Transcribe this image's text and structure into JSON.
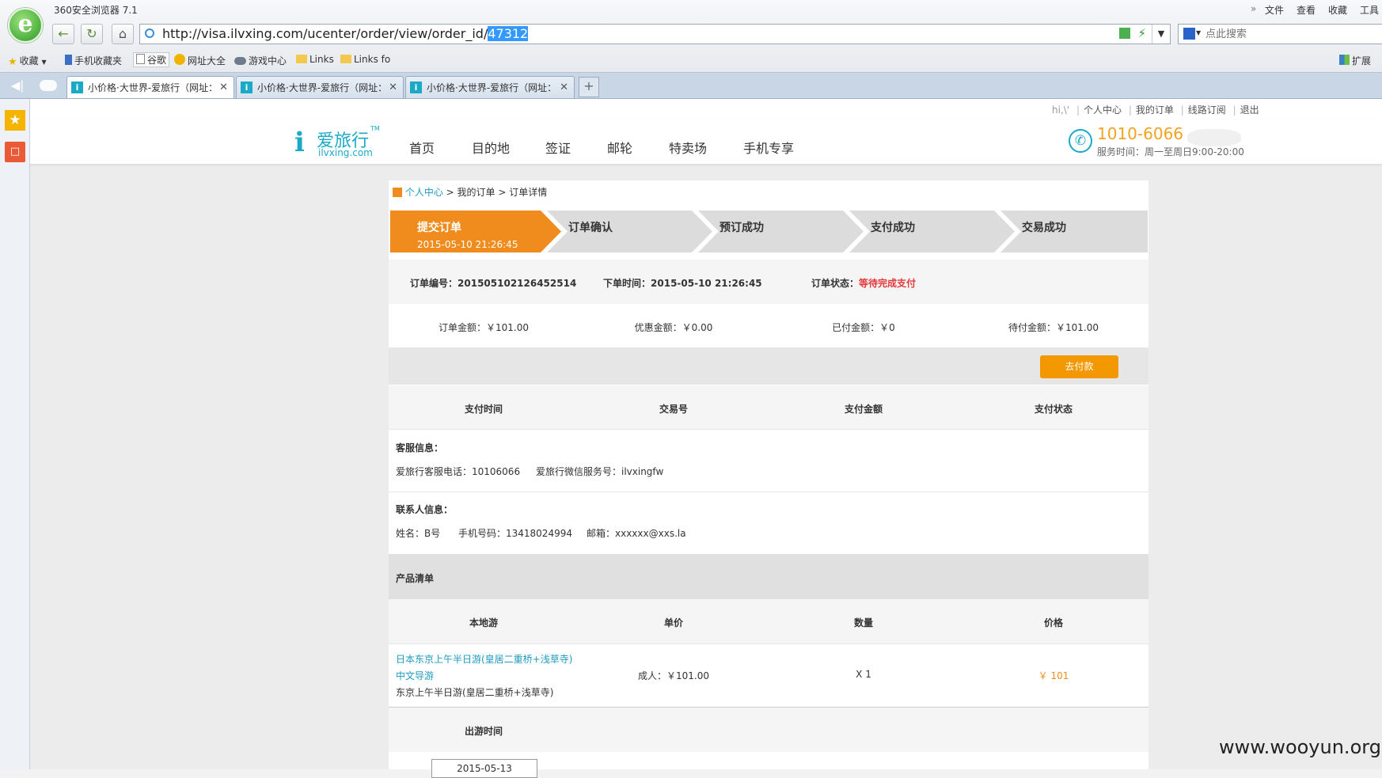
{
  "browser": {
    "app_title": "360安全浏览器 7.1",
    "menu": [
      "文件",
      "查看",
      "收藏",
      "工具"
    ],
    "url_prefix": "http://visa.ilvxing.com/ucenter/order/view/order_id/",
    "url_selected": "47312",
    "search_placeholder": "点此搜索",
    "bookmarks": [
      "收藏",
      "手机收藏夹",
      "谷歌",
      "网址大全",
      "游戏中心",
      "Links",
      "Links fo"
    ],
    "extend_label": "扩展",
    "tabs": [
      {
        "title": "小价格·大世界-爱旅行（网址：",
        "active": true
      },
      {
        "title": "小价格·大世界-爱旅行（网址：",
        "active": false
      },
      {
        "title": "小价格·大世界-爱旅行（网址：",
        "active": false
      }
    ],
    "new_tab_symbol": "+"
  },
  "site": {
    "userbar": [
      "hi,\\'",
      "个人中心",
      "我的订单",
      "线路订阅",
      "退出"
    ],
    "logo_cn": "爱旅行",
    "logo_tm": "TM",
    "logo_en": "ilvxing.com",
    "nav": [
      "首页",
      "目的地",
      "签证",
      "邮轮",
      "特卖场",
      "手机专享"
    ],
    "phone": "1010-6066",
    "service_hours": "服务时间：周一至周日9:00-20:00"
  },
  "breadcrumb": [
    "个人中心",
    "我的订单",
    "订单详情"
  ],
  "steps": [
    {
      "label": "提交订单",
      "time": "2015-05-10 21:26:45",
      "active": true
    },
    {
      "label": "订单确认",
      "time": "",
      "active": false
    },
    {
      "label": "预订成功",
      "time": "",
      "active": false
    },
    {
      "label": "支付成功",
      "time": "",
      "active": false
    },
    {
      "label": "交易成功",
      "time": "",
      "active": false
    }
  ],
  "order": {
    "number_label": "订单编号：",
    "number": "201505102126452514",
    "time_label": "下单时间：",
    "time": "2015-05-10 21:26:45",
    "status_label": "订单状态：",
    "status": "等待完成支付",
    "amount": "订单金额：￥101.00",
    "discount": "优惠金额：￥0.00",
    "paid": "已付金额：￥0",
    "due": "待付金额：￥101.00",
    "pay_button": "去付款"
  },
  "payment_table": {
    "headers": [
      "支付时间",
      "交易号",
      "支付金额",
      "支付状态"
    ]
  },
  "customer_service": {
    "title": "客服信息：",
    "phone": "爱旅行客服电话：10106066",
    "wechat": "爱旅行微信服务号：ilvxingfw"
  },
  "contact": {
    "title": "联系人信息：",
    "name": "姓名：B号",
    "mobile": "手机号码：13418024994",
    "email": "邮箱：xxxxxx@xxs.la"
  },
  "products": {
    "title": "产品清单",
    "headers": [
      "本地游",
      "单价",
      "数量",
      "价格"
    ],
    "item": {
      "name": "日本东京上午半日游(皇居二重桥+浅草寺)",
      "guide": "中文导游",
      "subtitle": "东京上午半日游(皇居二重桥+浅草寺)",
      "unit_price": "成人：￥101.00",
      "quantity": "X 1",
      "price": "￥ 101"
    },
    "departure_label": "出游时间",
    "departure_date": "2015-05-13"
  },
  "watermark": "www.wooyun.org",
  "colors": {
    "accent_orange": "#f08c1e",
    "link_blue": "#1e9bc0",
    "status_red": "#e4393c",
    "phone_orange": "#f3a31f"
  }
}
